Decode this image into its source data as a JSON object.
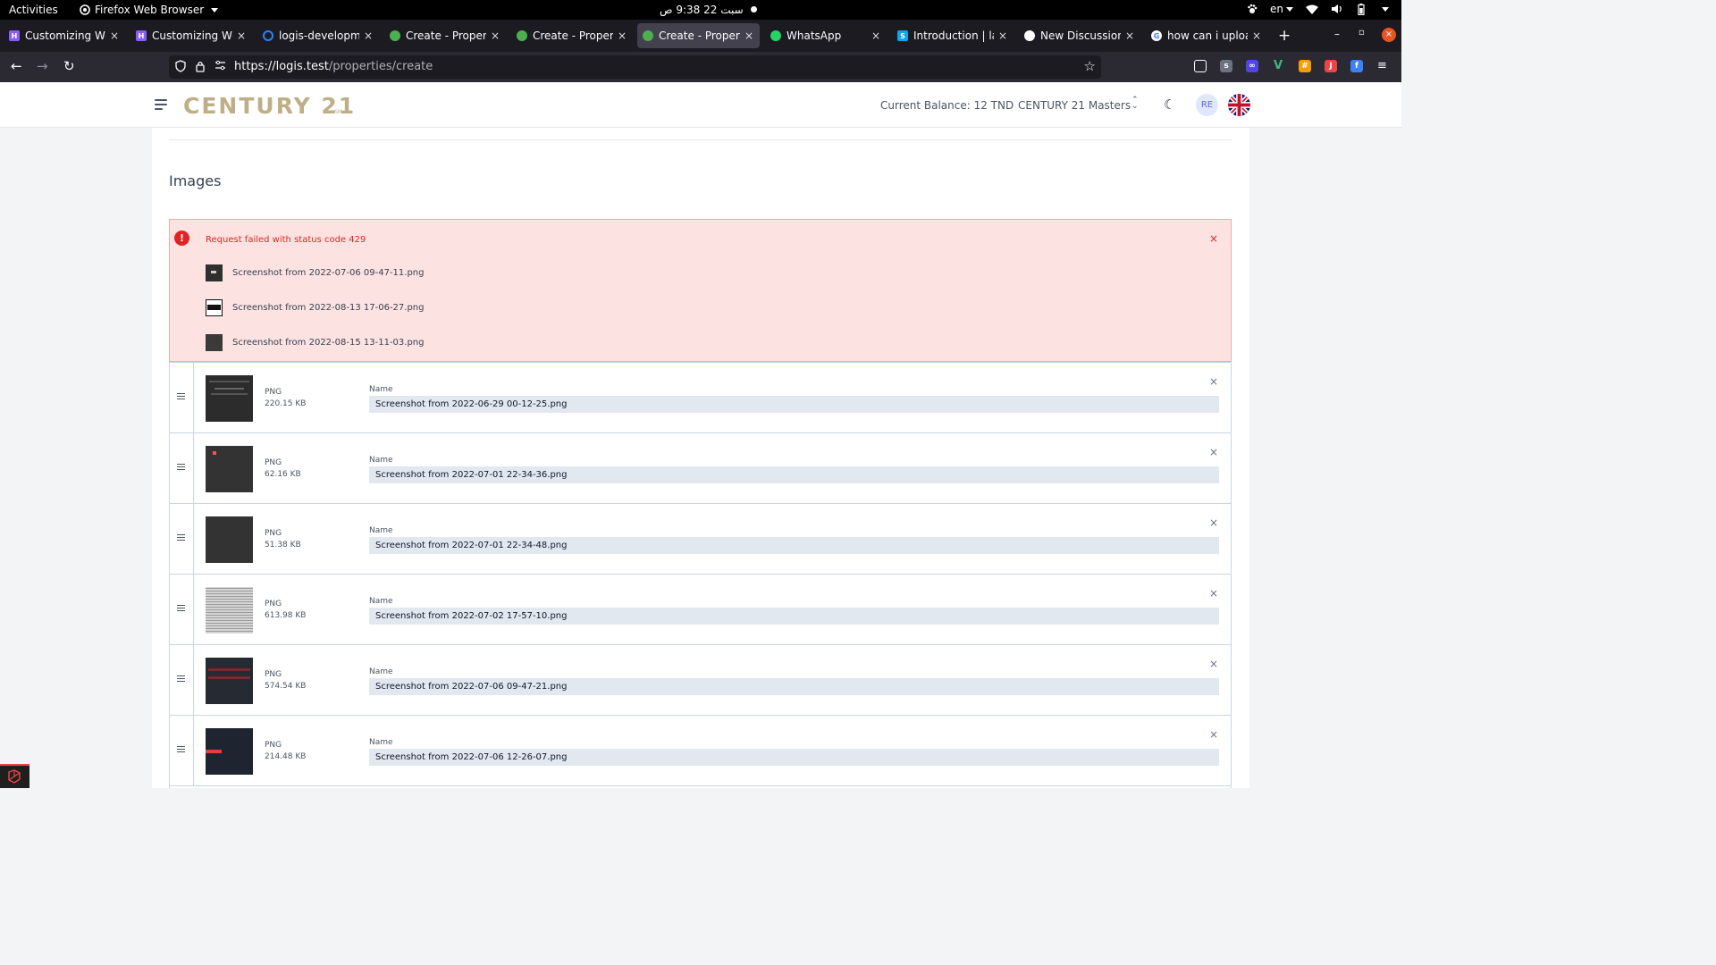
{
  "os_bar": {
    "activities": "Activities",
    "app_name": "Firefox Web Browser",
    "clock": "سبت 22  9:38 ص",
    "language": "en"
  },
  "tabs": [
    {
      "title": "Customizing Web",
      "active": false,
      "fav_color": "#8b5cf6",
      "fav_letter": "H"
    },
    {
      "title": "Customizing Web",
      "active": false,
      "fav_color": "#8b5cf6",
      "fav_letter": "H"
    },
    {
      "title": "logis-developmen",
      "active": false,
      "fav_color": "#2684ff",
      "fav_letter": ""
    },
    {
      "title": "Create - Property",
      "active": false,
      "fav_color": "#4caf50",
      "fav_letter": ""
    },
    {
      "title": "Create - Property",
      "active": false,
      "fav_color": "#4caf50",
      "fav_letter": ""
    },
    {
      "title": "Create - Property",
      "active": true,
      "fav_color": "#4caf50",
      "fav_letter": ""
    },
    {
      "title": "WhatsApp",
      "active": false,
      "fav_color": "#25d366",
      "fav_letter": ""
    },
    {
      "title": "Introduction | lara",
      "active": false,
      "fav_color": "#0ea5e9",
      "fav_letter": "S"
    },
    {
      "title": "New Discussion ·",
      "active": false,
      "fav_color": "#ffffff",
      "fav_letter": ""
    },
    {
      "title": "how can i upload",
      "active": false,
      "fav_color": "#ffffff",
      "fav_letter": "G"
    }
  ],
  "url": {
    "host": "https://logis.test",
    "path": "/properties/create"
  },
  "header": {
    "logo": "CENTURY 21",
    "logo_mark": "SM",
    "balance": "Current Balance: 12 TND",
    "agency": "CENTURY 21 Masters",
    "avatar_initials": "RE"
  },
  "images_section": {
    "title": "Images",
    "error": {
      "message": "Request failed with status code 429",
      "files": [
        "Screenshot from 2022-07-06 09-47-11.png",
        "Screenshot from 2022-08-13 17-06-27.png",
        "Screenshot from 2022-08-15 13-11-03.png"
      ]
    },
    "name_label": "Name",
    "uploads": [
      {
        "type": "PNG",
        "size": "220.15 KB",
        "name": "Screenshot from 2022-06-29 00-12-25.png"
      },
      {
        "type": "PNG",
        "size": "62.16 KB",
        "name": "Screenshot from 2022-07-01 22-34-36.png"
      },
      {
        "type": "PNG",
        "size": "51.38 KB",
        "name": "Screenshot from 2022-07-01 22-34-48.png"
      },
      {
        "type": "PNG",
        "size": "613.98 KB",
        "name": "Screenshot from 2022-07-02 17-57-10.png"
      },
      {
        "type": "PNG",
        "size": "574.54 KB",
        "name": "Screenshot from 2022-07-06 09-47-21.png"
      },
      {
        "type": "PNG",
        "size": "214.48 KB",
        "name": "Screenshot from 2022-07-06 12-26-07.png"
      }
    ]
  },
  "colors": {
    "brand_gold": "#beaf87",
    "error_bg": "#fde2e2",
    "error_text": "#dc2626",
    "active_tab": "#42414d"
  }
}
